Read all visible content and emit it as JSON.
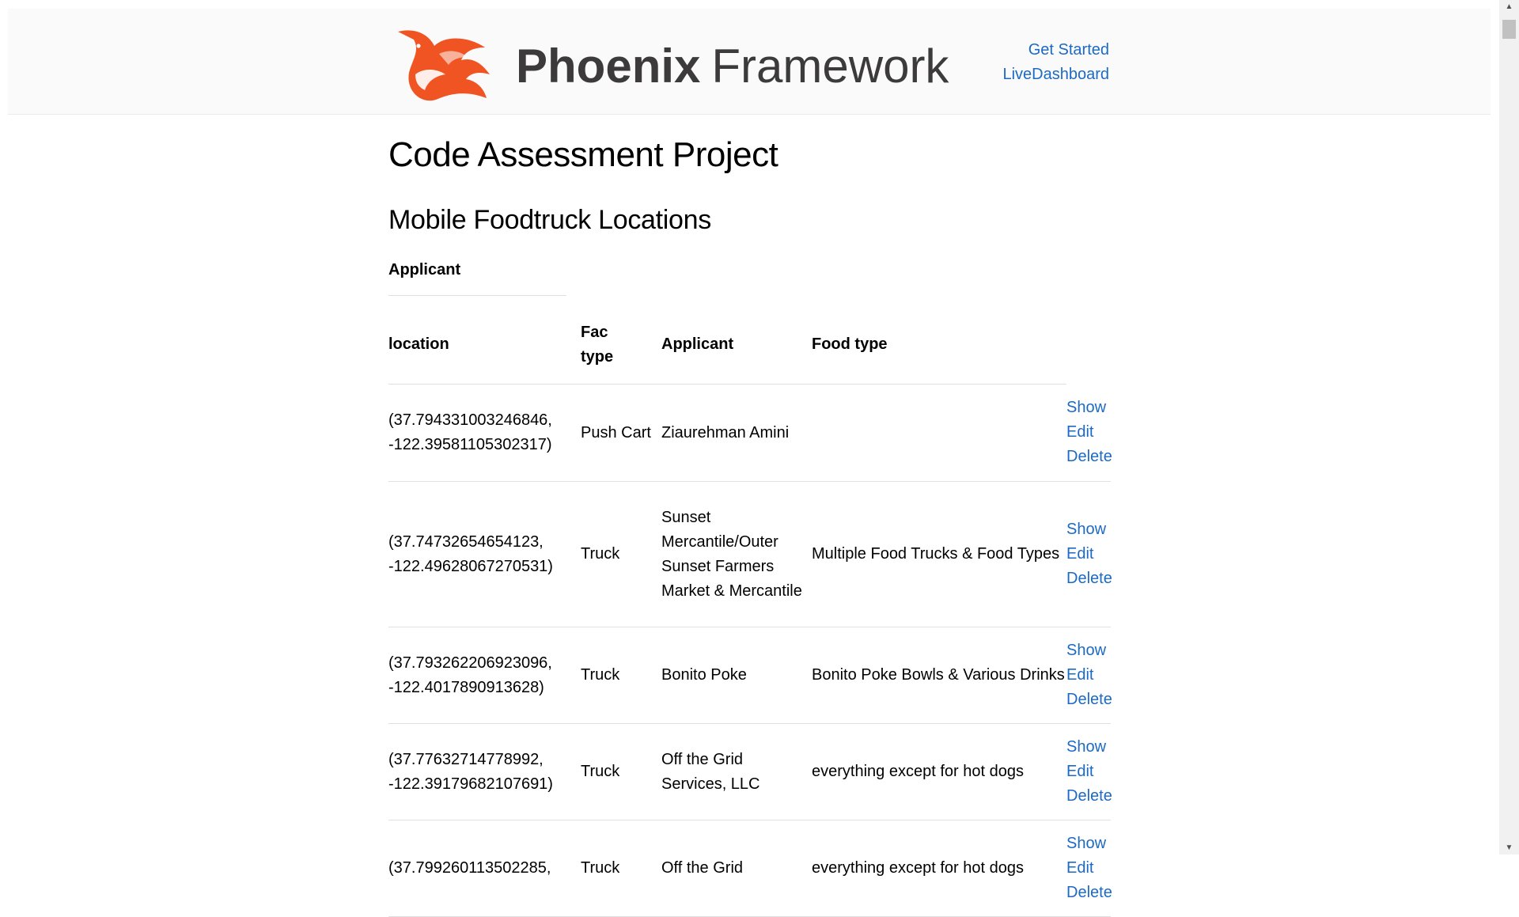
{
  "header": {
    "logo": {
      "bold": "Phoenix",
      "light": "Framework"
    },
    "nav": [
      "Get Started",
      "LiveDashboard"
    ]
  },
  "page": {
    "title": "Code Assessment Project",
    "subtitle": "Mobile Foodtruck Locations"
  },
  "sort_label": "Applicant",
  "table": {
    "columns": [
      "location",
      "Fac type",
      "Applicant",
      "Food type"
    ],
    "rows": [
      {
        "location": "(37.794331003246846, -122.39581105302317)",
        "fac_type": "Push Cart",
        "applicant": "Ziaurehman Amini",
        "food_type": ""
      },
      {
        "location": "(37.74732654654123, -122.49628067270531)",
        "fac_type": "Truck",
        "applicant": "Sunset Mercantile/Outer Sunset Farmers Market & Mercantile",
        "food_type": "Multiple Food Trucks & Food Types"
      },
      {
        "location": "(37.793262206923096, -122.4017890913628)",
        "fac_type": "Truck",
        "applicant": "Bonito Poke",
        "food_type": "Bonito Poke Bowls & Various Drinks"
      },
      {
        "location": "(37.77632714778992, -122.39179682107691)",
        "fac_type": "Truck",
        "applicant": "Off the Grid Services, LLC",
        "food_type": "everything except for hot dogs"
      },
      {
        "location": "(37.799260113502285,",
        "fac_type": "Truck",
        "applicant": "Off the Grid",
        "food_type": "everything except for hot dogs"
      }
    ],
    "actions": [
      "Show",
      "Edit",
      "Delete"
    ]
  },
  "icons": {
    "logo": "phoenix-bird-icon",
    "scroll_up": "arrow-up-icon",
    "scroll_down": "arrow-down-icon"
  },
  "colors": {
    "link": "#1c6ac4",
    "logo_orange": "#f05423",
    "header_bg": "#fafafa"
  }
}
